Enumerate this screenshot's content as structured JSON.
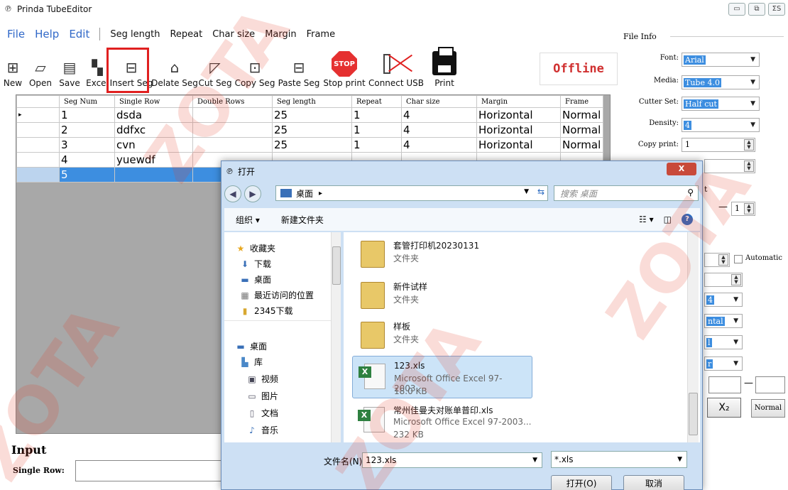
{
  "window": {
    "title": "Prinda TubeEditor",
    "controls": [
      "▭",
      "⧉",
      "ΣS"
    ]
  },
  "menu": {
    "main": [
      "File",
      "Help",
      "Edit"
    ],
    "items": [
      "Seg length",
      "Repeat",
      "Char size",
      "Margin",
      "Frame"
    ]
  },
  "toolbar": {
    "buttons": [
      {
        "label": "New",
        "icon": "new-doc-icon"
      },
      {
        "label": "Open",
        "icon": "open-folder-icon"
      },
      {
        "label": "Save",
        "icon": "save-icon"
      },
      {
        "label": "Excel",
        "icon": "excel-import-icon"
      },
      {
        "label": "Insert Seg",
        "icon": "insert-seg-icon"
      },
      {
        "label": "Delate Seg",
        "icon": "delete-seg-icon"
      },
      {
        "label": "Cut Seg",
        "icon": "cut-seg-icon"
      },
      {
        "label": "Copy Seg",
        "icon": "copy-seg-icon"
      },
      {
        "label": "Paste Seg",
        "icon": "paste-seg-icon"
      }
    ],
    "stop_icon_text": "STOP",
    "stop_label": "Stop print",
    "usb_label": "Connect USB",
    "print_label": "Print",
    "status": "Offline",
    "highlight_color": "#e02020"
  },
  "grid": {
    "columns": [
      "Seg Num",
      "Single Row",
      "Double Rows",
      "Seg length",
      "Repeat",
      "Char size",
      "Margin",
      "Frame"
    ],
    "rows": [
      [
        "1",
        "dsda",
        "",
        "25",
        "1",
        "4",
        "Horizontal",
        "Normal"
      ],
      [
        "2",
        "ddfxc",
        "",
        "25",
        "1",
        "4",
        "Horizontal",
        "Normal"
      ],
      [
        "3",
        "cvn",
        "",
        "25",
        "1",
        "4",
        "Horizontal",
        "Normal"
      ],
      [
        "4",
        "yuewdf",
        "",
        "",
        "",
        "",
        "",
        ""
      ],
      [
        "5",
        "",
        "",
        "",
        "",
        "",
        "",
        ""
      ]
    ],
    "selected_row": 5,
    "row_indicator": "▸"
  },
  "input": {
    "heading": "Input",
    "single_row_label": "Single Row:"
  },
  "file_info": {
    "title": "File Info",
    "font_label": "Font:",
    "font_value": "Arial",
    "media_label": "Media:",
    "media_value": "Tube 4.0",
    "cutter_label": "Cutter Set:",
    "cutter_value": "Half cut",
    "density_label": "Density:",
    "density_value": "4",
    "copy_label": "Copy print:",
    "copy_value": "1",
    "partial_t": "t",
    "dash": "—",
    "range_value": "1",
    "automatic_label": "Automatic",
    "partial_4": "4",
    "partial_ntal": "ntal",
    "partial_l": "l",
    "partial_r": "r",
    "x2_label": "X₂",
    "normal_label": "Normal"
  },
  "dialog": {
    "title": "打开",
    "close_label": "X",
    "address": "桌面",
    "search_placeholder": "搜索 桌面",
    "organize": "组织 ▾",
    "new_folder": "新建文件夹",
    "nav": [
      {
        "label": "收藏夹",
        "icon": "star-icon"
      },
      {
        "label": "下载",
        "icon": "download-icon"
      },
      {
        "label": "桌面",
        "icon": "desktop-icon"
      },
      {
        "label": "最近访问的位置",
        "icon": "recent-icon"
      },
      {
        "label": "2345下载",
        "icon": "folder-icon"
      },
      {
        "label": "桌面",
        "icon": "desktop-icon"
      },
      {
        "label": "库",
        "icon": "library-icon"
      },
      {
        "label": "视频",
        "icon": "video-icon"
      },
      {
        "label": "图片",
        "icon": "picture-icon"
      },
      {
        "label": "文档",
        "icon": "document-icon"
      },
      {
        "label": "音乐",
        "icon": "music-icon"
      }
    ],
    "files": [
      {
        "name": "套管打印机20230131",
        "type": "文件夹",
        "size": "",
        "kind": "folder"
      },
      {
        "name": "新件试样",
        "type": "文件夹",
        "size": "",
        "kind": "folder"
      },
      {
        "name": "样板",
        "type": "文件夹",
        "size": "",
        "kind": "folder"
      },
      {
        "name": "123.xls",
        "type": "Microsoft Office Excel 97-2003...",
        "size": "18.0 KB",
        "kind": "xls"
      },
      {
        "name": "常州佳曼夫对账单普印.xls",
        "type": "Microsoft Office Excel 97-2003...",
        "size": "232 KB",
        "kind": "xls"
      }
    ],
    "selected_file": 3,
    "filename_label": "文件名(N):",
    "filename_value": "123.xls",
    "filetype_value": "*.xls",
    "open_button": "打开(O)",
    "cancel_button": "取消"
  },
  "watermark": "ZOTA"
}
